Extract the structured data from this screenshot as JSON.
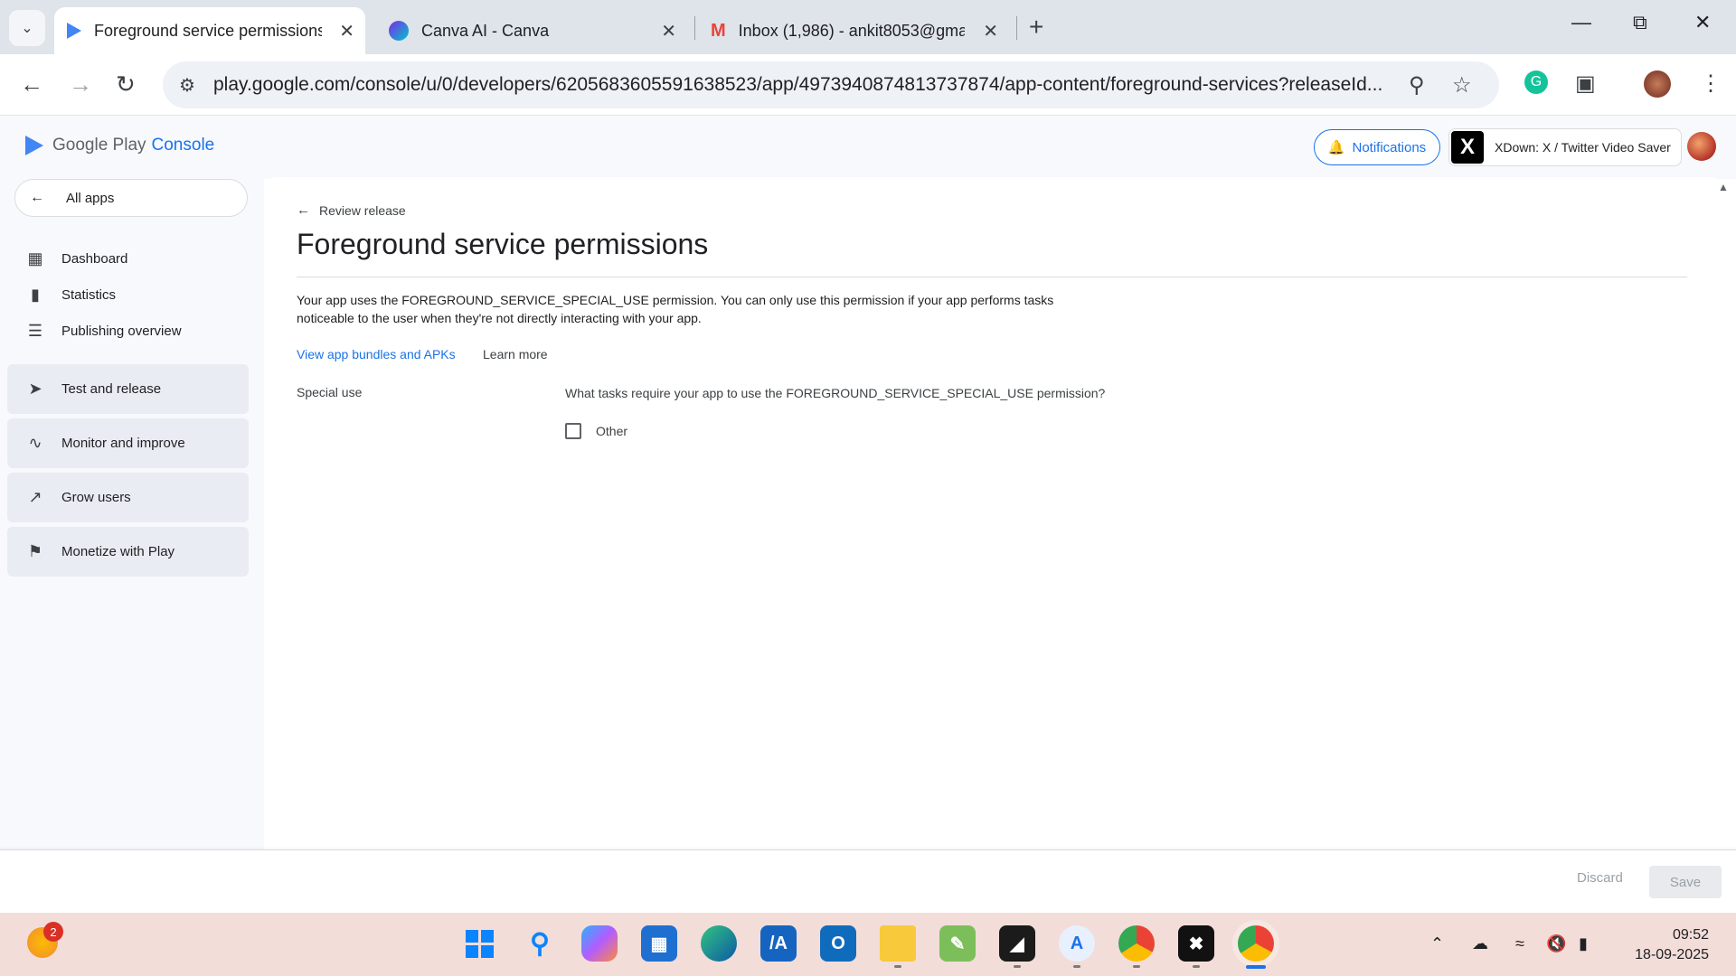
{
  "browser": {
    "tabs": [
      {
        "title": "Foreground service permissions",
        "active": true
      },
      {
        "title": "Canva AI - Canva",
        "active": false
      },
      {
        "title": "Inbox (1,986) - ankit8053@gma",
        "active": false
      }
    ],
    "url": "play.google.com/console/u/0/developers/6205683605591638523/app/4973940874813737874/app-content/foreground-services?releaseId..."
  },
  "header": {
    "logo_text": "Google Play",
    "logo_suffix": "Console",
    "notifications_label": "Notifications",
    "extension_label": "XDown: X / Twitter Video Saver"
  },
  "sidebar": {
    "all_apps": "All apps",
    "items": [
      {
        "label": "Dashboard",
        "icon": "dashboard-icon"
      },
      {
        "label": "Statistics",
        "icon": "bar-chart-icon"
      },
      {
        "label": "Publishing overview",
        "icon": "publishing-icon"
      }
    ],
    "groups": [
      {
        "label": "Test and release",
        "icon": "rocket-icon"
      },
      {
        "label": "Monitor and improve",
        "icon": "vitals-icon"
      },
      {
        "label": "Grow users",
        "icon": "grow-icon"
      },
      {
        "label": "Monetize with Play",
        "icon": "tag-icon"
      }
    ]
  },
  "main": {
    "back_label": "Review release",
    "title": "Foreground service permissions",
    "description": "Your app uses the FOREGROUND_SERVICE_SPECIAL_USE permission. You can only use this permission if your app performs tasks noticeable to the user when they're not directly interacting with your app.",
    "link_bundles": "View app bundles and APKs",
    "link_learn": "Learn more",
    "field_label": "Special use",
    "question": "What tasks require your app to use the FOREGROUND_SERVICE_SPECIAL_USE permission?",
    "option_other": "Other",
    "option_other_checked": false
  },
  "footer": {
    "discard_label": "Discard",
    "save_label": "Save"
  },
  "taskbar": {
    "weather_badge": "2",
    "time": "09:52",
    "date": "18-09-2025"
  },
  "colors": {
    "accent": "#1a73e8",
    "sidebar_bg": "#f7f9fd",
    "taskbar_bg": "#f3ddd8"
  }
}
